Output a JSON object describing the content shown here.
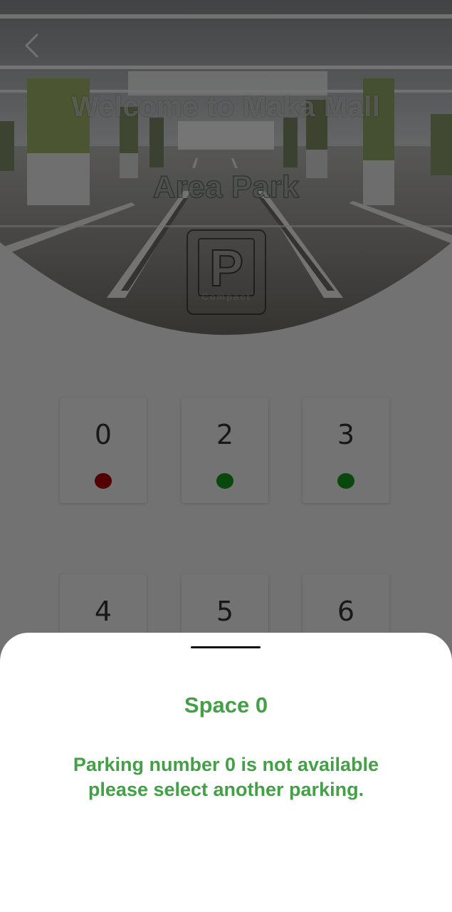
{
  "header": {
    "back_icon": "chevron-left-icon",
    "title": "Welcome to Maka Mall",
    "subtitle": "Area Park",
    "sign_letter": "P",
    "sign_caption": "Compact"
  },
  "spaces": [
    {
      "number": "0",
      "status": "unavailable"
    },
    {
      "number": "2",
      "status": "available"
    },
    {
      "number": "3",
      "status": "available"
    },
    {
      "number": "4",
      "status": "unknown"
    },
    {
      "number": "5",
      "status": "unknown"
    },
    {
      "number": "6",
      "status": "unknown"
    }
  ],
  "status_colors": {
    "available": "#129a1c",
    "unavailable": "#b00000"
  },
  "sheet": {
    "title": "Space 0",
    "message": "Parking number 0 is not available please select another parking."
  },
  "accent_color": "#43a047"
}
